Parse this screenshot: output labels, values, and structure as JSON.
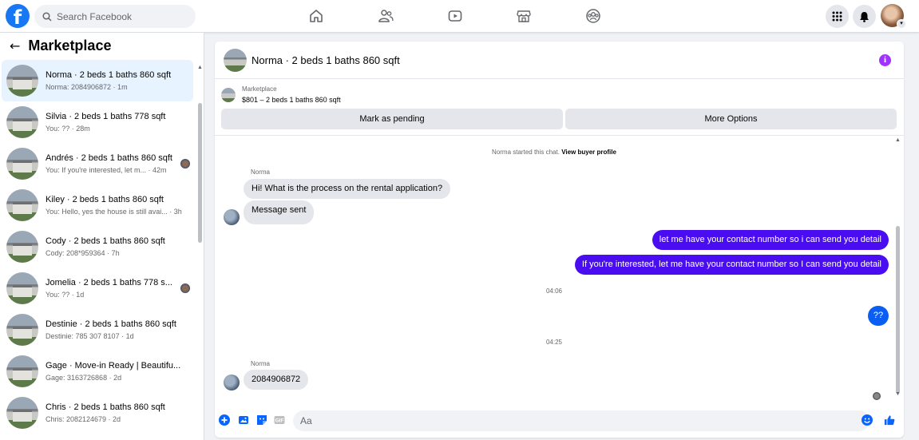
{
  "topbar": {
    "logo": "f",
    "search_placeholder": "Search Facebook",
    "nav_icons": [
      "home-icon",
      "friends-icon",
      "watch-icon",
      "marketplace-icon",
      "groups-icon"
    ],
    "right_icons": [
      "menu-grid-icon",
      "notifications-icon",
      "account-avatar"
    ]
  },
  "sidebar": {
    "back_glyph": "←",
    "title": "Marketplace",
    "conversations": [
      {
        "title": "Norma · 2 beds 1 baths 860 sqft",
        "subtitle": "Norma: 2084906872 · 1m"
      },
      {
        "title": "Silvia · 2 beds 1 baths 778 sqft",
        "subtitle": "You: ?? · 28m"
      },
      {
        "title": "Andrés · 2 beds 1 baths 860 sqft",
        "subtitle": "You: If you're interested, let m... · 42m"
      },
      {
        "title": "Kiley · 2 beds 1 baths 860 sqft",
        "subtitle": "You: Hello, yes the house is still avai... · 3h"
      },
      {
        "title": "Cody · 2 beds 1 baths 860 sqft",
        "subtitle": "Cody: 208*959364 · 7h"
      },
      {
        "title": "Jomelia · 2 beds 1 baths 778 s...",
        "subtitle": "You: ?? · 1d"
      },
      {
        "title": "Destinie · 2 beds 1 baths 860 sqft",
        "subtitle": "Destinie: 785 307 8107 · 1d"
      },
      {
        "title": "Gage · Move-in Ready | Beautifu...",
        "subtitle": "Gage: 3163726868 · 2d"
      },
      {
        "title": "Chris · 2 beds 1 baths 860 sqft",
        "subtitle": "Chris: 2082124679 · 2d"
      }
    ]
  },
  "chat": {
    "header_name": "Norma · 2 beds 1 baths 860 sqft",
    "info_glyph": "i",
    "listing_category": "Marketplace",
    "listing_price": "$801 – 2 beds 1 baths 860 sqft",
    "btn_pending": "Mark as pending",
    "btn_more": "More Options",
    "system_text": "Norma started this chat.",
    "system_link": "View buyer profile",
    "sender_name_1": "Norma",
    "msg_in_1": "Hi! What is the process on the rental application?",
    "msg_in_2": "Message sent",
    "msg_out_1": "let me have your contact number so i can send you detail",
    "msg_out_2": "If you're interested,  let me have your contact number so I can send you detail",
    "time_1": "04:06",
    "msg_out_3": "??",
    "time_2": "04:25",
    "sender_name_2": "Norma",
    "msg_in_3": "2084906872",
    "composer_placeholder": "Aa"
  },
  "colors": {
    "brand": "#1877f2",
    "outgoing_bubble": "#4a0df2",
    "info": "#a033ff"
  }
}
